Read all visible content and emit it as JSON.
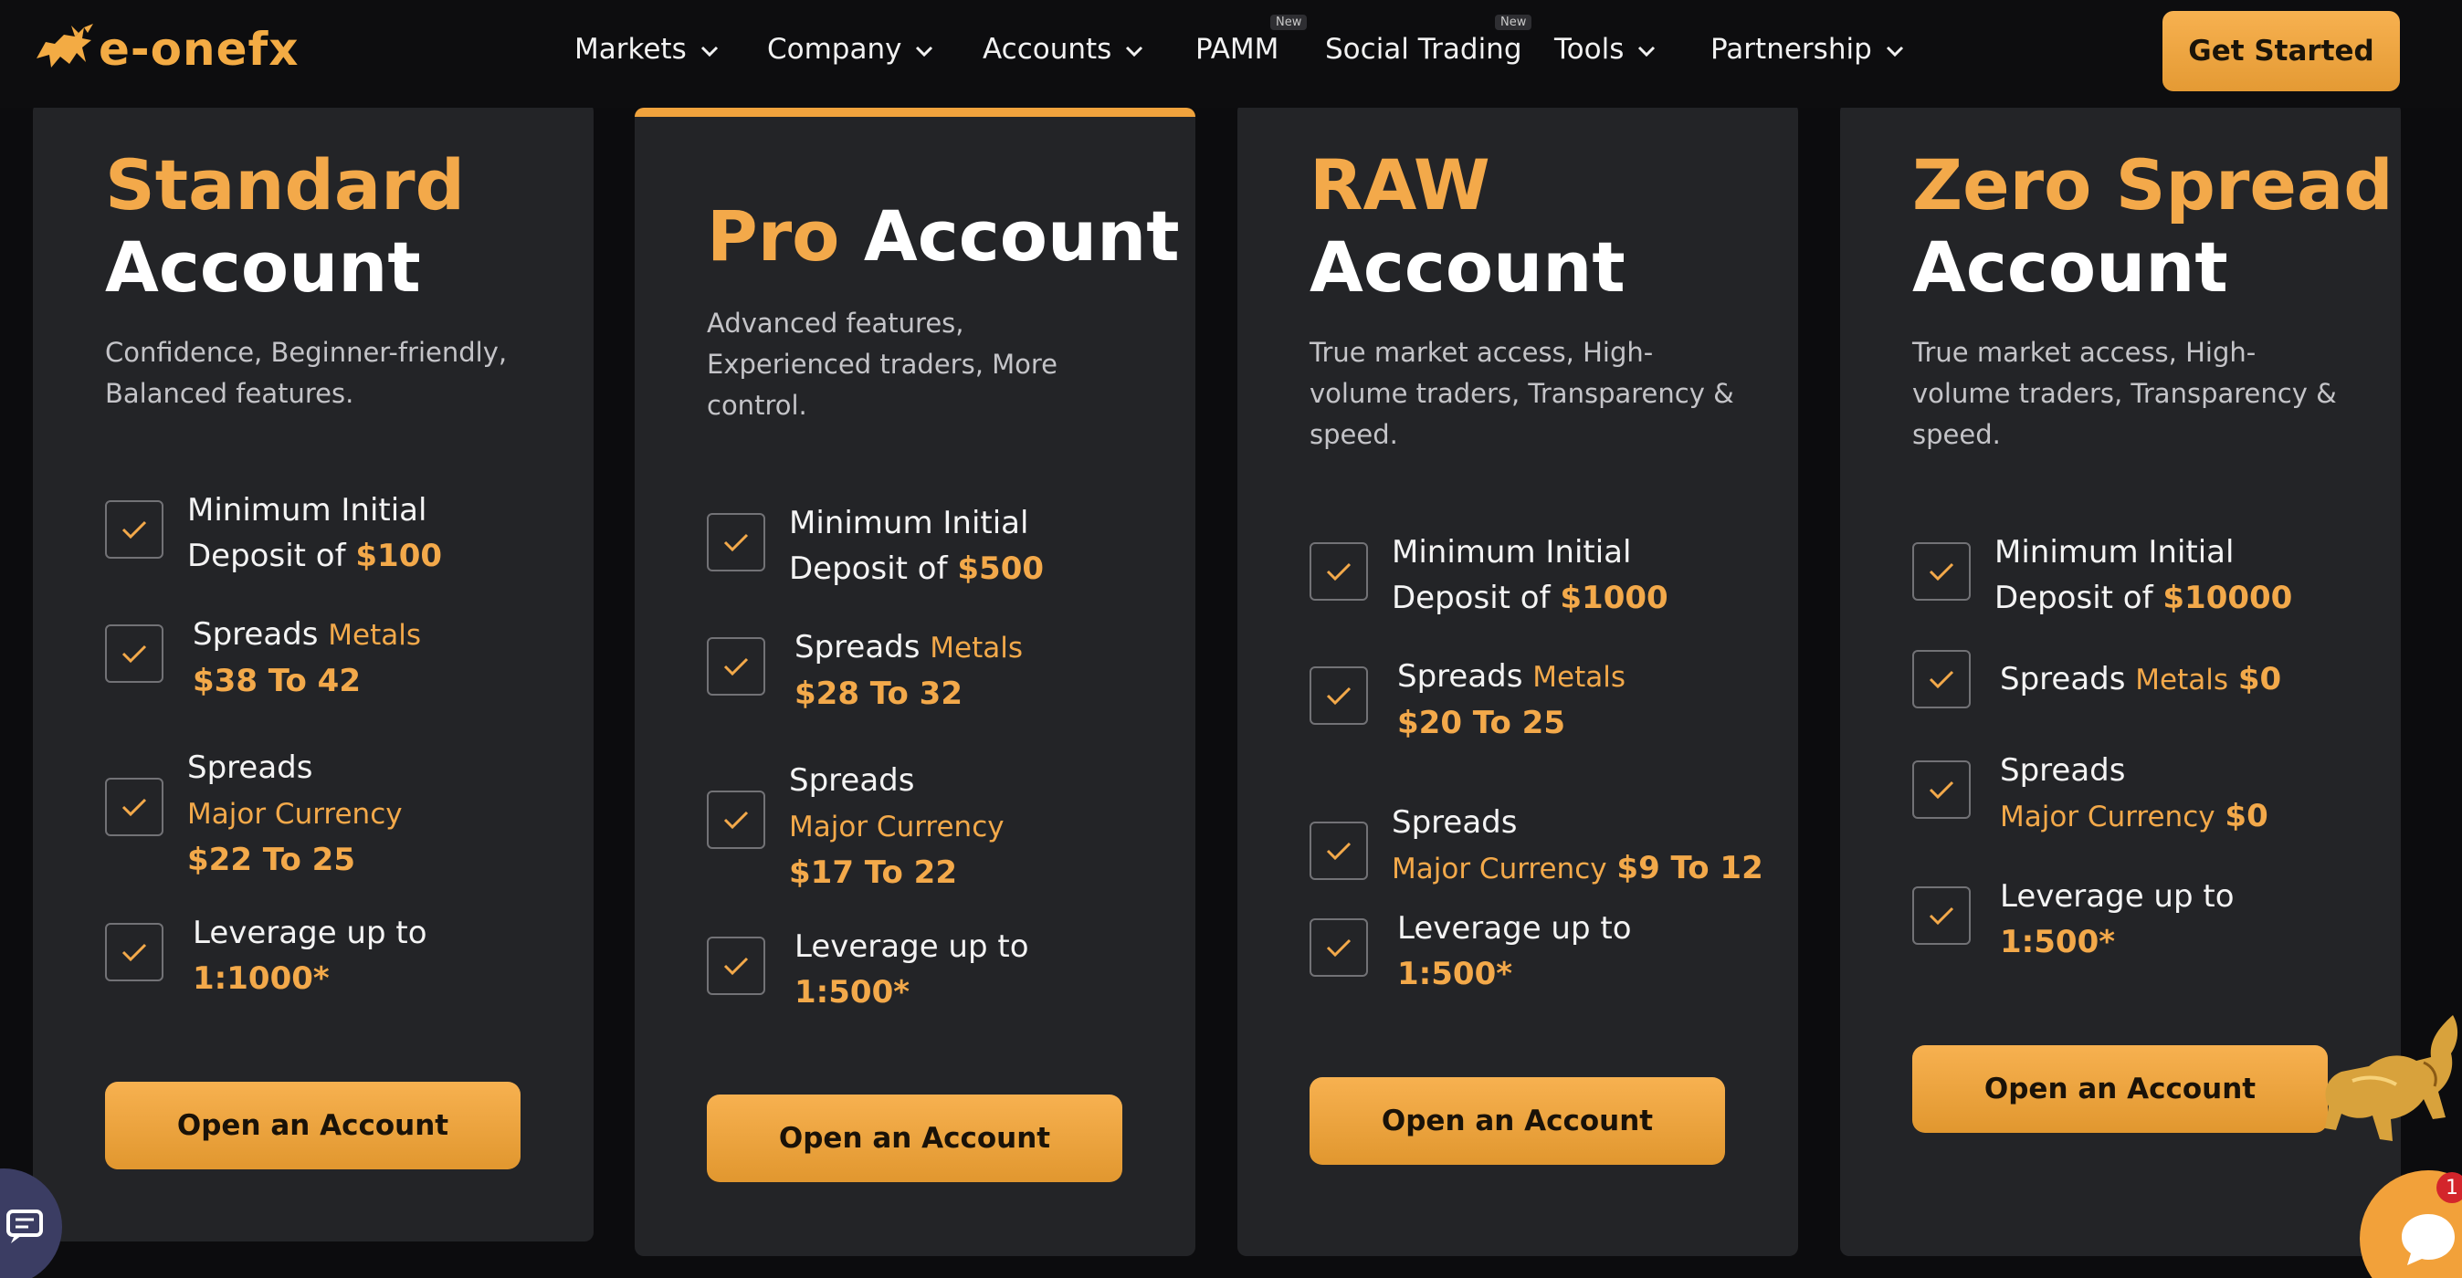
{
  "brand": {
    "logo_text": "e-onefx",
    "accent": "#f3a94a"
  },
  "nav": {
    "items": [
      {
        "label": "Markets",
        "dropdown": true
      },
      {
        "label": "Company",
        "dropdown": true
      },
      {
        "label": "Accounts",
        "dropdown": true
      },
      {
        "label": "PAMM",
        "dropdown": false,
        "badge": "New"
      },
      {
        "label": "Social Trading",
        "dropdown": false,
        "badge": "New"
      },
      {
        "label": "Tools",
        "dropdown": true
      },
      {
        "label": "Partnership",
        "dropdown": true
      }
    ],
    "cta": "Get Started"
  },
  "cards": [
    {
      "title_accent": "Standard",
      "title_rest": "Account",
      "description": "Confidence, Beginner-friendly, Balanced features.",
      "deposit_label": "Minimum Initial",
      "deposit_prefix": "Deposit of",
      "deposit_amount": "$100",
      "metals_label": "Spreads",
      "metals_tag": "Metals",
      "metals_value": "$38 To 42",
      "currency_label": "Spreads",
      "currency_tag": "Major Currency",
      "currency_value": "$22 To 25",
      "leverage_label": "Leverage up to",
      "leverage_value": "1:1000*",
      "cta": "Open an Account"
    },
    {
      "title_accent": "Pro",
      "title_rest": "Account",
      "description": "Advanced features, Experienced traders, More control.",
      "deposit_label": "Minimum Initial",
      "deposit_prefix": "Deposit of",
      "deposit_amount": "$500",
      "metals_label": "Spreads",
      "metals_tag": "Metals",
      "metals_value": "$28 To 32",
      "currency_label": "Spreads",
      "currency_tag": "Major Currency",
      "currency_value": "$17 To 22",
      "leverage_label": "Leverage up to",
      "leverage_value": "1:500*",
      "cta": "Open an Account"
    },
    {
      "title_accent": "RAW",
      "title_rest": "Account",
      "description": "True market access, High-volume traders, Transparency & speed.",
      "deposit_label": "Minimum Initial",
      "deposit_prefix": "Deposit of",
      "deposit_amount": "$1000",
      "metals_label": "Spreads",
      "metals_tag": "Metals",
      "metals_value": "$20 To 25",
      "currency_label": "Spreads",
      "currency_tag": "Major Currency",
      "currency_value": "$9 To 12",
      "leverage_label": "Leverage up to",
      "leverage_value": "1:500*",
      "cta": "Open an Account"
    },
    {
      "title_accent": "Zero Spread",
      "title_rest": "Account",
      "description": "True market access, High-volume traders, Transparency & speed.",
      "deposit_label": "Minimum Initial",
      "deposit_prefix": "Deposit of",
      "deposit_amount": "$10000",
      "metals_label": "Spreads",
      "metals_tag": "Metals",
      "metals_value": "$0",
      "currency_label": "Spreads",
      "currency_tag": "Major Currency",
      "currency_value": "$0",
      "leverage_label": "Leverage up to",
      "leverage_value": "1:500*",
      "cta": "Open an Account"
    }
  ],
  "chat": {
    "unread_count": "1"
  }
}
